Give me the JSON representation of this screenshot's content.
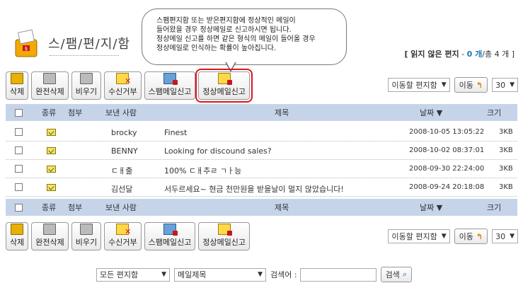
{
  "header": {
    "title": "스/팸/편/지/함"
  },
  "summary": {
    "label": "[ 읽지 않은 편지",
    "dash": " - ",
    "unread": "0 개",
    "total": "/총 4 개 ]"
  },
  "tooltip": {
    "lines": [
      "스팸편지함 또는 받은편지함에 정상적인 메일이",
      "들어왔을 경우 정상메일로 신고하시면 됩니다.",
      "정상메일 신고를 하면 같은 형식의 메일이 들어올 경우",
      "정상메일로 인식하는 확률이 높아집니다."
    ]
  },
  "toolbar": {
    "buttons": [
      {
        "label": "삭제",
        "icon": "trash-icon"
      },
      {
        "label": "완전삭제",
        "icon": "trash-can-icon"
      },
      {
        "label": "비우기",
        "icon": "empty-trash-icon"
      },
      {
        "label": "수신거부",
        "icon": "reject-mail-icon"
      },
      {
        "label": "스팸메일신고",
        "icon": "spam-report-icon"
      },
      {
        "label": "정상메일신고",
        "icon": "normal-report-icon"
      }
    ],
    "move_select": "이동할 편지함",
    "move_button": "이동",
    "page_size": "30"
  },
  "table": {
    "headers": {
      "kind": "종류",
      "attach": "첨부",
      "sender": "보낸 사람",
      "subject": "제목",
      "date": "날짜 ▼",
      "size": "크기"
    },
    "rows": [
      {
        "sender": "brocky",
        "subject": "Finest",
        "date": "2008-10-05 13:05:22",
        "size": "3KB"
      },
      {
        "sender": "BENNY",
        "subject": "Looking for discound sales?",
        "date": "2008-10-02 08:37:01",
        "size": "3KB"
      },
      {
        "sender": "ㄷㅐ출",
        "subject": "100% ㄷㅐ추ㄹ ㄱㅏ능",
        "date": "2008-09-30 22:24:00",
        "size": "3KB"
      },
      {
        "sender": "김선달",
        "subject": "서두르세요~ 현금 천만원을 받을날이 멀지 않았습니다!",
        "date": "2008-09-24 20:18:08",
        "size": "3KB"
      }
    ]
  },
  "search": {
    "folder_select": "모든 편지함",
    "field_select": "메일제목",
    "label": "검색어 :",
    "input_value": "",
    "button": "검색"
  },
  "colors": {
    "header_bg": "#c6d4ea",
    "highlight": "#e0141e",
    "accent": "#1a7ab8"
  }
}
